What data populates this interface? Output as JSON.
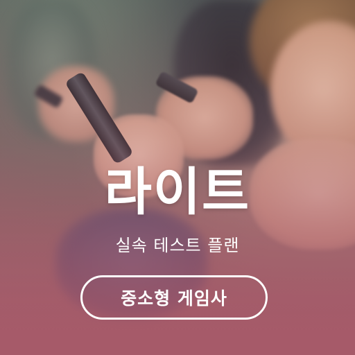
{
  "banner": {
    "title": "라이트",
    "subtitle": "실속 테스트 플랜",
    "cta_label": "중소형 게임사"
  },
  "colors": {
    "overlay_tint": "#a85466",
    "text": "#ffffff",
    "button_border": "#ffffff"
  }
}
